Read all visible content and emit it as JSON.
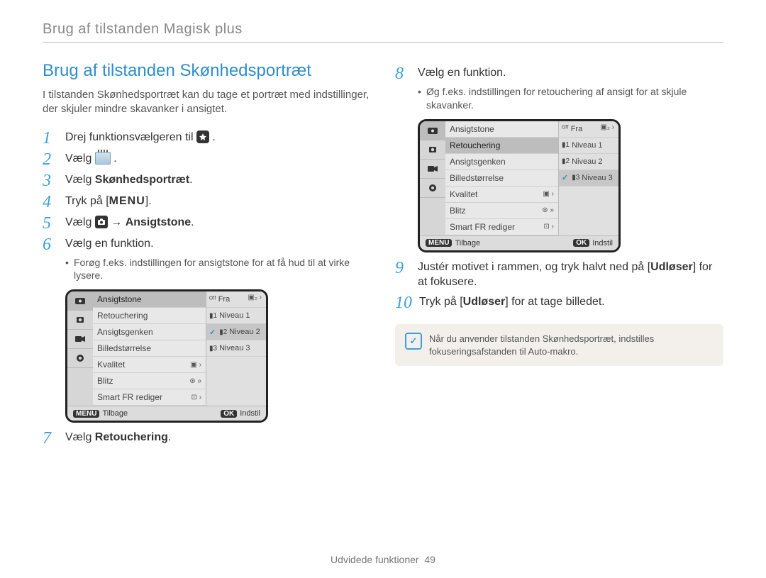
{
  "breadcrumb": "Brug af tilstanden Magisk plus",
  "section_title": "Brug af tilstanden Skønhedsportræt",
  "intro": "I tilstanden Skønhedsportræt kan du tage et portræt med indstillinger, der skjuler mindre skavanker i ansigtet.",
  "steps": {
    "s1_pre": "Drej funktionsvælgeren til ",
    "s1_post": ".",
    "s2_pre": "Vælg ",
    "s2_post": ".",
    "s3_pre": "Vælg ",
    "s3_bold": "Skønhedsportræt",
    "s3_post": ".",
    "s4_pre": "Tryk på [",
    "s4_menu": "MENU",
    "s4_post": "].",
    "s5_pre": "Vælg ",
    "s5_arrow": " → ",
    "s5_bold": "Ansigtstone",
    "s5_post": ".",
    "s6": "Vælg en funktion.",
    "s6_sub": "Forøg f.eks. indstillingen for ansigtstone for at få hud til at virke lysere.",
    "s7_pre": "Vælg ",
    "s7_bold": "Retouchering",
    "s7_post": ".",
    "s8": "Vælg en funktion.",
    "s8_sub": "Øg f.eks. indstillingen for retouchering af ansigt for at skjule skavanker.",
    "s9_a": "Justér motivet i rammen, og tryk halvt ned på [",
    "s9_bold": "Udløser",
    "s9_b": "] for at fokusere.",
    "s10_a": "Tryk på [",
    "s10_bold": "Udløser",
    "s10_b": "] for at tage billedet."
  },
  "menu_left": {
    "items": [
      "Ansigtstone",
      "Retouchering",
      "Ansigtsgenken",
      "Billedstørrelse",
      "Kvalitet",
      "Blitz",
      "Smart FR rediger"
    ],
    "selected_index": 0,
    "options": [
      {
        "label": "Fra",
        "icon": "OFF"
      },
      {
        "label": "Niveau 1",
        "icon": "1"
      },
      {
        "label": "Niveau 2",
        "icon": "2",
        "selected": true
      },
      {
        "label": "Niveau 3",
        "icon": "3"
      }
    ],
    "right_badges": [
      "",
      "",
      "",
      "",
      "▣ ›",
      "⊛ »",
      "⊡ ›"
    ],
    "footer_back": "Tilbage",
    "footer_set": "Indstil",
    "key_back": "MENU",
    "key_ok": "OK",
    "top_indicator": "▣₂ ›"
  },
  "menu_right": {
    "items": [
      "Ansigtstone",
      "Retouchering",
      "Ansigtsgenken",
      "Billedstørrelse",
      "Kvalitet",
      "Blitz",
      "Smart FR rediger"
    ],
    "selected_index": 1,
    "options": [
      {
        "label": "Fra",
        "icon": "OFF"
      },
      {
        "label": "Niveau 1",
        "icon": "1"
      },
      {
        "label": "Niveau 2",
        "icon": "2"
      },
      {
        "label": "Niveau 3",
        "icon": "3",
        "selected": true
      }
    ],
    "right_badges": [
      "",
      "",
      "",
      "",
      "▣ ›",
      "⊛ »",
      "⊡ ›"
    ],
    "footer_back": "Tilbage",
    "footer_set": "Indstil",
    "key_back": "MENU",
    "key_ok": "OK",
    "top_indicator": "▣₂ ›"
  },
  "note": "Når du anvender tilstanden Skønhedsportræt, indstilles fokuseringsafstanden til Auto-makro.",
  "footer_text": "Udvidede funktioner",
  "footer_page": "49"
}
